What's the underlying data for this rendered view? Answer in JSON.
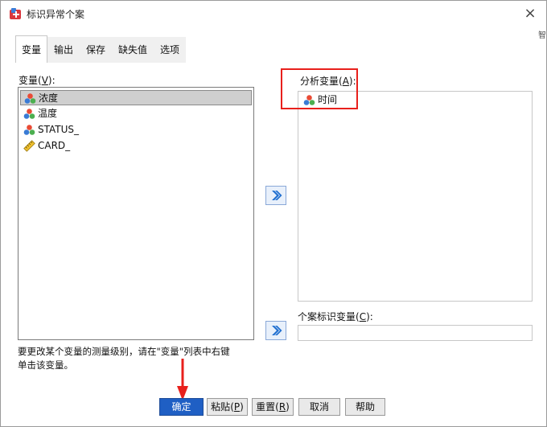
{
  "window": {
    "title": "标识异常个案",
    "close": "×"
  },
  "edge_text": "智",
  "tabs": [
    {
      "label": "变量",
      "active": true
    },
    {
      "label": "输出"
    },
    {
      "label": "保存"
    },
    {
      "label": "缺失值"
    },
    {
      "label": "选项"
    }
  ],
  "variables": {
    "label_prefix": "变量(",
    "label_key": "V",
    "label_suffix": "):",
    "items": [
      {
        "name": "浓度",
        "icon": "nominal-icon",
        "selected": true
      },
      {
        "name": "温度",
        "icon": "nominal-icon"
      },
      {
        "name": "STATUS_",
        "icon": "nominal-icon"
      },
      {
        "name": "CARD_",
        "icon": "scale-ruler-icon"
      }
    ]
  },
  "analysis": {
    "label_prefix": "分析变量(",
    "label_key": "A",
    "label_suffix": "):",
    "items": [
      {
        "name": "时间",
        "icon": "nominal-icon"
      }
    ]
  },
  "case_id": {
    "label_prefix": "个案标识变量(",
    "label_key": "C",
    "label_suffix": "):",
    "value": ""
  },
  "hint": {
    "line1": "要更改某个变量的测量级别，请在\"变量\"列表中右键",
    "line2": "单击该变量。"
  },
  "buttons": [
    {
      "label": "确定",
      "primary": true
    },
    {
      "label": "粘贴",
      "key": "P"
    },
    {
      "label": "重置",
      "key": "R"
    },
    {
      "label": "取消"
    },
    {
      "label": "帮助"
    }
  ],
  "colors": {
    "accent": "#1f5fc4",
    "highlight": "#e8201c",
    "arrow": "#1f6fd0"
  }
}
